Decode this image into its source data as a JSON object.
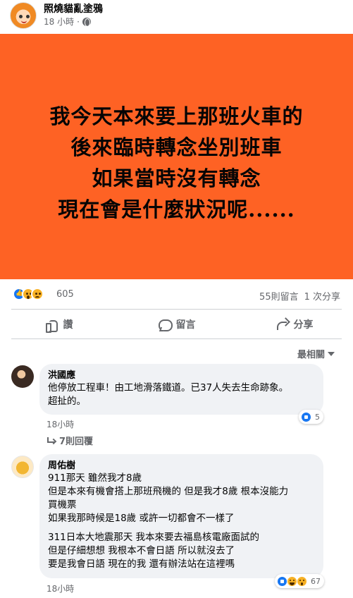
{
  "post": {
    "author": "照燒貓亂塗鴉",
    "time": "18 小時",
    "separator": "·",
    "privacy_icon": "globe-icon"
  },
  "banner": {
    "background": "#fe6224",
    "lines": [
      "我今天本來要上那班火車的",
      "後來臨時轉念坐別班車",
      "如果當時沒有轉念",
      "現在會是什麼狀況呢......"
    ]
  },
  "stats": {
    "reaction_icons": [
      "like-icon",
      "wow-icon",
      "sad-icon"
    ],
    "reaction_count": "605",
    "comments": "55則留言",
    "shares": "1 次分享"
  },
  "actions": {
    "like": "讚",
    "comment": "留言",
    "share": "分享"
  },
  "sort": {
    "label": "最相關"
  },
  "comments": [
    {
      "name": "洪國應",
      "lines": [
        "他停放工程車！由工地滑落鐵道。已37人失去生命跡象。",
        "超扯的。"
      ],
      "reaction_count": "5",
      "time": "18小時",
      "replies": "7則回覆"
    },
    {
      "name": "周佑樹",
      "paragraphs": [
        [
          "911那天  雖然我才8歲",
          "但是本來有機會搭上那班飛機的 但是我才8歲 根本沒能力",
          "買機票",
          "如果我那時候是18歲 或許一切都會不一樣了"
        ],
        [
          "311日本大地震那天 我本來要去福島核電廠面試的",
          "但是仔細想想 我根本不會日語 所以就沒去了",
          "要是我會日語 現在的我 還有辦法站在這裡嗎"
        ]
      ],
      "reaction_count": "67",
      "time": "18小時"
    }
  ]
}
